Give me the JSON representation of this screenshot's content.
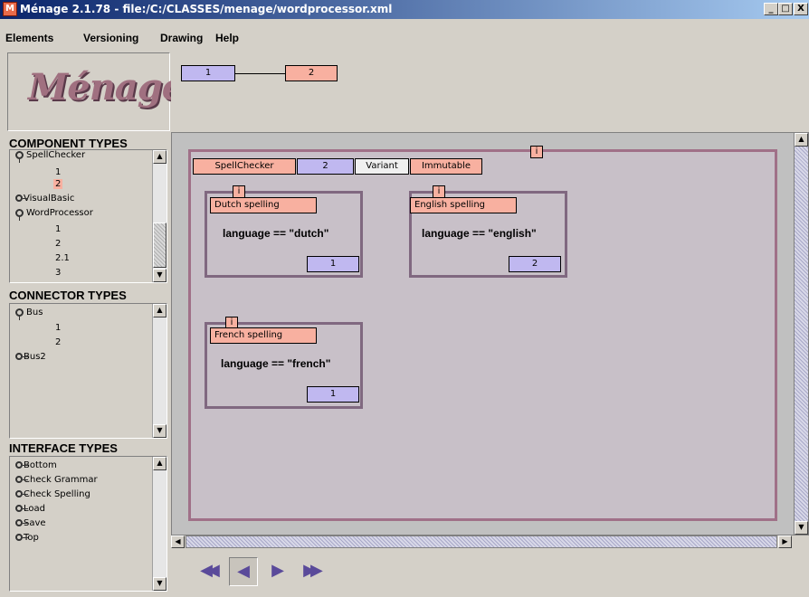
{
  "window": {
    "title": "Ménage 2.1.78 - file:/C:/CLASSES/menage/wordprocessor.xml",
    "minimize": "_",
    "maximize": "□",
    "close": "X"
  },
  "menu": {
    "elements": "Elements",
    "versioning": "Versioning",
    "drawing": "Drawing",
    "help": "Help"
  },
  "logo": "Ménage",
  "component_types": {
    "heading": "COMPONENT TYPES",
    "items": [
      {
        "label": "SpellChecker",
        "type": "key"
      },
      {
        "label": "1",
        "type": "leaf"
      },
      {
        "label": "2",
        "type": "leaf-selected"
      },
      {
        "label": "VisualBasic",
        "type": "open"
      },
      {
        "label": "WordProcessor",
        "type": "key"
      },
      {
        "label": "1",
        "type": "leaf"
      },
      {
        "label": "2",
        "type": "leaf"
      },
      {
        "label": "2.1",
        "type": "leaf"
      },
      {
        "label": "3",
        "type": "leaf"
      }
    ]
  },
  "connector_types": {
    "heading": "CONNECTOR TYPES",
    "items": [
      {
        "label": "Bus",
        "type": "key"
      },
      {
        "label": "1",
        "type": "leaf"
      },
      {
        "label": "2",
        "type": "leaf"
      },
      {
        "label": "Bus2",
        "type": "open"
      }
    ]
  },
  "interface_types": {
    "heading": "INTERFACE TYPES",
    "items": [
      {
        "label": "Bottom"
      },
      {
        "label": "Check Grammar"
      },
      {
        "label": "Check Spelling"
      },
      {
        "label": "Load"
      },
      {
        "label": "Save"
      },
      {
        "label": "Top"
      }
    ]
  },
  "version_graph": {
    "node1": "1",
    "node2": "2"
  },
  "canvas": {
    "info_badge": "i",
    "header": {
      "name": "SpellChecker",
      "version": "2",
      "kind": "Variant",
      "state": "Immutable"
    },
    "variants": [
      {
        "name": "Dutch spelling",
        "condition": "language == \"dutch\"",
        "version": "1",
        "badge": "i"
      },
      {
        "name": "English spelling",
        "condition": "language == \"english\"",
        "version": "2",
        "badge": "i"
      },
      {
        "name": "French spelling",
        "condition": "language == \"french\"",
        "version": "1",
        "badge": "i"
      }
    ]
  },
  "colors": {
    "salmon": "#f8b0a0",
    "lavender": "#c0b8f0",
    "frame": "#a07088"
  },
  "nav": {
    "first": "◀◀",
    "prev": "◀",
    "next": "▶",
    "last": "▶▶"
  }
}
